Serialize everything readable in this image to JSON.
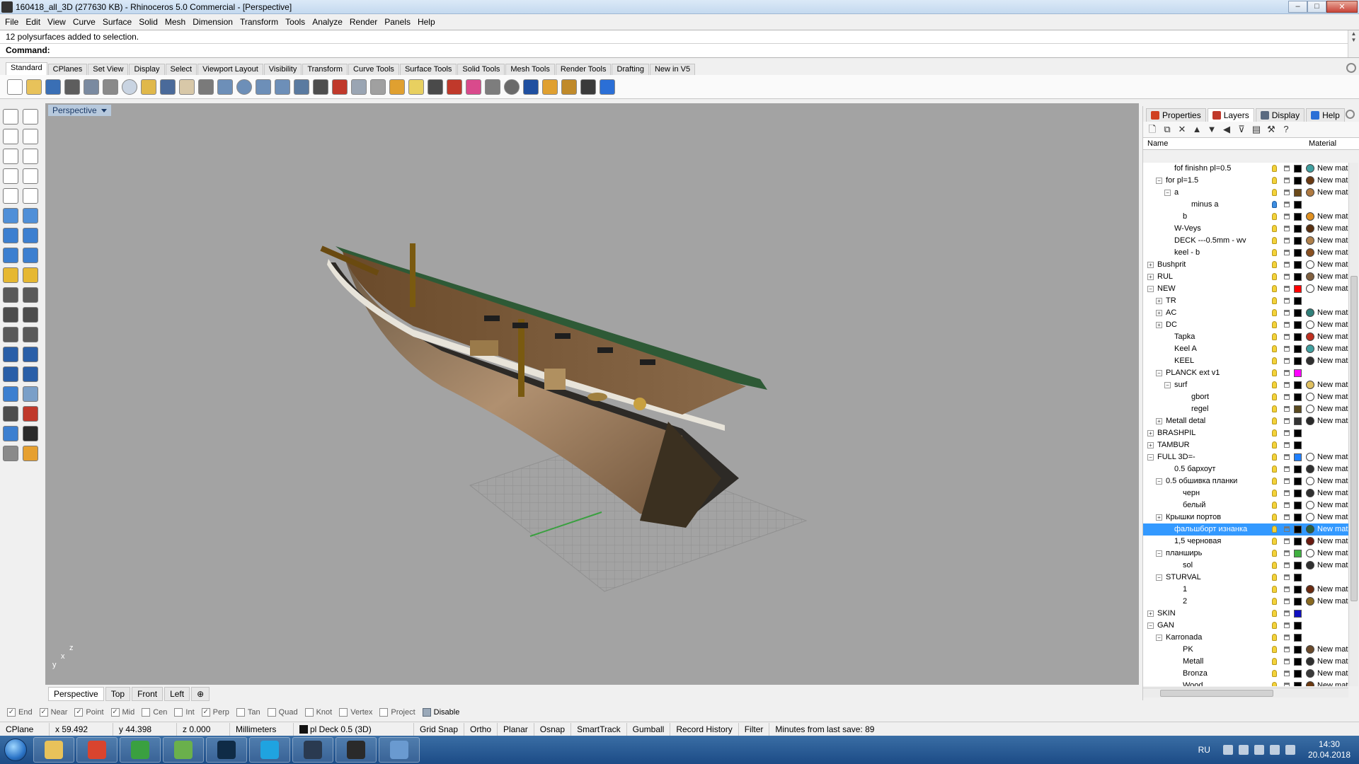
{
  "window": {
    "title": "160418_all_3D (277630 KB) - Rhinoceros 5.0 Commercial - [Perspective]",
    "minimize": "–",
    "maximize": "□",
    "close": "✕"
  },
  "menu": [
    "File",
    "Edit",
    "View",
    "Curve",
    "Surface",
    "Solid",
    "Mesh",
    "Dimension",
    "Transform",
    "Tools",
    "Analyze",
    "Render",
    "Panels",
    "Help"
  ],
  "command": {
    "history": "12 polysurfaces added to selection.",
    "prompt": "Command:",
    "scroll_up": "▲",
    "scroll_down": "▼"
  },
  "toolbar_tabs": [
    "Standard",
    "CPlanes",
    "Set View",
    "Display",
    "Select",
    "Viewport Layout",
    "Visibility",
    "Transform",
    "Curve Tools",
    "Surface Tools",
    "Solid Tools",
    "Mesh Tools",
    "Render Tools",
    "Drafting",
    "New in V5"
  ],
  "toolbar_icons": [
    {
      "name": "new-icon",
      "color": "#ffffff"
    },
    {
      "name": "open-icon",
      "color": "#e8c25a"
    },
    {
      "name": "save-icon",
      "color": "#3a6fb5"
    },
    {
      "name": "print-icon",
      "color": "#5d5d5d"
    },
    {
      "name": "import-icon",
      "color": "#7a8aa0"
    },
    {
      "name": "cut-icon",
      "color": "#8a8a8a"
    },
    {
      "name": "copy-icon",
      "color": "#c9d4e2"
    },
    {
      "name": "paste-icon",
      "color": "#e0b84a"
    },
    {
      "name": "undo-icon",
      "color": "#4a6a9a"
    },
    {
      "name": "pan-icon",
      "color": "#d8c8a8"
    },
    {
      "name": "rotate-view-icon",
      "color": "#7a7a7a"
    },
    {
      "name": "zoom-icon",
      "color": "#6d8fb8"
    },
    {
      "name": "zoom-window-icon",
      "color": "#6d8fb8"
    },
    {
      "name": "zoom-extents-icon",
      "color": "#6d8fb8"
    },
    {
      "name": "zoom-selected-icon",
      "color": "#6d8fb8"
    },
    {
      "name": "undo-view-icon",
      "color": "#5a7aa0"
    },
    {
      "name": "four-viewports-icon",
      "color": "#4d4d4d"
    },
    {
      "name": "car-icon",
      "color": "#c0392b"
    },
    {
      "name": "shade-icon",
      "color": "#9aa5b3"
    },
    {
      "name": "cplane-icon",
      "color": "#a0a0a0"
    },
    {
      "name": "points-icon",
      "color": "#e0a030"
    },
    {
      "name": "light-icon",
      "color": "#e8d060"
    },
    {
      "name": "lock-icon",
      "color": "#4a4a4a"
    },
    {
      "name": "layer-icon",
      "color": "#c0392b"
    },
    {
      "name": "color-wheel-icon",
      "color": "#d94a8c"
    },
    {
      "name": "sphere-icon",
      "color": "#7d7d7d"
    },
    {
      "name": "render-sphere-icon",
      "color": "#6a6a6a"
    },
    {
      "name": "material-sphere-icon",
      "color": "#1f4fa0"
    },
    {
      "name": "filter-icon",
      "color": "#e0a030"
    },
    {
      "name": "settings-icon",
      "color": "#c08a2a"
    },
    {
      "name": "dimension-icon",
      "color": "#3a3a3a"
    },
    {
      "name": "help-icon",
      "color": "#2b6fd6"
    }
  ],
  "left_tools": [
    {
      "name": "select-arrow-icon",
      "color": "#ffffff"
    },
    {
      "name": "point-icon",
      "color": "#ffffff"
    },
    {
      "name": "polyline-icon",
      "color": "#ffffff"
    },
    {
      "name": "curve-icon",
      "color": "#ffffff"
    },
    {
      "name": "circle-icon",
      "color": "#ffffff"
    },
    {
      "name": "arc-icon",
      "color": "#ffffff"
    },
    {
      "name": "polygon-icon",
      "color": "#ffffff"
    },
    {
      "name": "rectangle-icon",
      "color": "#ffffff"
    },
    {
      "name": "ellipse-icon",
      "color": "#ffffff"
    },
    {
      "name": "fillet-icon",
      "color": "#ffffff"
    },
    {
      "name": "surface-icon",
      "color": "#4f8fd8"
    },
    {
      "name": "loft-icon",
      "color": "#4f8fd8"
    },
    {
      "name": "box-icon",
      "color": "#3c7fd0"
    },
    {
      "name": "boolean-icon",
      "color": "#3c7fd0"
    },
    {
      "name": "cylinder-icon",
      "color": "#3c7fd0"
    },
    {
      "name": "mesh-icon",
      "color": "#3c7fd0"
    },
    {
      "name": "light-icon",
      "color": "#e6b832"
    },
    {
      "name": "dimension-icon",
      "color": "#e6b832"
    },
    {
      "name": "trim-icon",
      "color": "#5a5a5a"
    },
    {
      "name": "split-icon",
      "color": "#5a5a5a"
    },
    {
      "name": "join-icon",
      "color": "#4d4d4d"
    },
    {
      "name": "explode-icon",
      "color": "#4d4d4d"
    },
    {
      "name": "offset-icon",
      "color": "#5a5a5a"
    },
    {
      "name": "extend-icon",
      "color": "#5a5a5a"
    },
    {
      "name": "text-icon",
      "color": "#2a5fa8"
    },
    {
      "name": "scale-icon",
      "color": "#2a5fa8"
    },
    {
      "name": "move-icon",
      "color": "#2a5fa8"
    },
    {
      "name": "mirror-icon",
      "color": "#2a5fa8"
    },
    {
      "name": "array-icon",
      "color": "#3c7fd0"
    },
    {
      "name": "grid-icon",
      "color": "#7a9fc8"
    },
    {
      "name": "snap-icon",
      "color": "#4d4d4d"
    },
    {
      "name": "analyze-icon",
      "color": "#c0392b"
    },
    {
      "name": "check-icon",
      "color": "#3c7fd0"
    },
    {
      "name": "checkmark-icon",
      "color": "#2a2a2a"
    },
    {
      "name": "block-icon",
      "color": "#8a8a8a"
    },
    {
      "name": "render-icon",
      "color": "#e6a030"
    }
  ],
  "viewport": {
    "title": "Perspective",
    "axis_z": "z",
    "axis_x": "x",
    "axis_y": "y",
    "tabs": [
      "Perspective",
      "Top",
      "Front",
      "Left"
    ],
    "add_tab": "⊕"
  },
  "osnaps": [
    {
      "label": "End",
      "checked": true
    },
    {
      "label": "Near",
      "checked": true
    },
    {
      "label": "Point",
      "checked": true
    },
    {
      "label": "Mid",
      "checked": true
    },
    {
      "label": "Cen",
      "checked": false
    },
    {
      "label": "Int",
      "checked": false
    },
    {
      "label": "Perp",
      "checked": true
    },
    {
      "label": "Tan",
      "checked": false
    },
    {
      "label": "Quad",
      "checked": false
    },
    {
      "label": "Knot",
      "checked": false
    },
    {
      "label": "Vertex",
      "checked": false
    },
    {
      "label": "Project",
      "checked": false
    },
    {
      "label": "Disable",
      "checked": false
    }
  ],
  "status": {
    "cplane": "CPlane",
    "x": "x 59.492",
    "y": "y 44.398",
    "z": "z 0.000",
    "units": "Millimeters",
    "layer": "pl Deck 0.5 (3D)",
    "grid_snap": "Grid Snap",
    "ortho": "Ortho",
    "planar": "Planar",
    "osnap": "Osnap",
    "smarttrack": "SmartTrack",
    "gumball": "Gumball",
    "record_history": "Record History",
    "filter": "Filter",
    "save_info": "Minutes from last save: 89"
  },
  "panel": {
    "tabs": [
      {
        "label": "Properties",
        "color": "#d04020"
      },
      {
        "label": "Layers",
        "color": "#c0392b"
      },
      {
        "label": "Display",
        "color": "#5a6a80"
      },
      {
        "label": "Help",
        "color": "#2b6fd6"
      }
    ],
    "tool_icons": [
      {
        "name": "new-layer-icon",
        "glyph": "🗋"
      },
      {
        "name": "new-sublayer-icon",
        "glyph": "⧉"
      },
      {
        "name": "delete-icon",
        "glyph": "✕"
      },
      {
        "name": "move-up-icon",
        "glyph": "▲"
      },
      {
        "name": "move-down-icon",
        "glyph": "▼"
      },
      {
        "name": "move-parent-icon",
        "glyph": "◀"
      },
      {
        "name": "filter-icon",
        "glyph": "⊽"
      },
      {
        "name": "print-icon",
        "glyph": "▤"
      },
      {
        "name": "tools-icon",
        "glyph": "⚒"
      },
      {
        "name": "help-icon",
        "glyph": "?"
      }
    ],
    "col_name": "Name",
    "col_material": "Material"
  },
  "layers": [
    {
      "name": "fof finishn pl=0.5",
      "indent": 2,
      "toggle": "",
      "color": "#000000",
      "mat": "#40a0a0",
      "mtext": "New mat",
      "bulb": "yellow"
    },
    {
      "name": "for pl=1.5",
      "indent": 1,
      "toggle": "−",
      "color": "#000000",
      "mat": "#6b3a12",
      "mtext": "New mat",
      "bulb": "yellow"
    },
    {
      "name": "a",
      "indent": 2,
      "toggle": "−",
      "color": "#6b4a1a",
      "mat": "#b07a40",
      "mtext": "New mat",
      "bulb": "yellow"
    },
    {
      "name": "minus a",
      "indent": 4,
      "toggle": "",
      "color": "#000000",
      "mat": "",
      "mtext": "",
      "bulb": "blue"
    },
    {
      "name": "b",
      "indent": 3,
      "toggle": "",
      "color": "#000000",
      "mat": "#e09020",
      "mtext": "New mat",
      "bulb": "yellow"
    },
    {
      "name": "W-Veys",
      "indent": 2,
      "toggle": "",
      "color": "#000000",
      "mat": "#5a3010",
      "mtext": "New mat",
      "bulb": "yellow"
    },
    {
      "name": "DECK ---0.5mm - wv",
      "indent": 2,
      "toggle": "",
      "color": "#000000",
      "mat": "#b0804a",
      "mtext": "New mat",
      "bulb": "yellow"
    },
    {
      "name": "keel - b",
      "indent": 2,
      "toggle": "",
      "color": "#000000",
      "mat": "#8a5020",
      "mtext": "New mat",
      "bulb": "yellow"
    },
    {
      "name": "Bushprit",
      "indent": 0,
      "toggle": "+",
      "color": "#000000",
      "mat": "#ffffff",
      "mtext": "New mat",
      "bulb": "yellow"
    },
    {
      "name": "RUL",
      "indent": 0,
      "toggle": "+",
      "color": "#000000",
      "mat": "#806040",
      "mtext": "New mat",
      "bulb": "yellow"
    },
    {
      "name": "NEW",
      "indent": 0,
      "toggle": "−",
      "color": "#ff0000",
      "mat": "#ffffff",
      "mtext": "New mat",
      "bulb": "yellow"
    },
    {
      "name": "TR",
      "indent": 1,
      "toggle": "+",
      "color": "#000000",
      "mat": "",
      "mtext": "",
      "bulb": "yellow"
    },
    {
      "name": "AC",
      "indent": 1,
      "toggle": "+",
      "color": "#000000",
      "mat": "#30807a",
      "mtext": "New mat",
      "bulb": "yellow"
    },
    {
      "name": "DC",
      "indent": 1,
      "toggle": "+",
      "color": "#000000",
      "mat": "#ffffff",
      "mtext": "New mat",
      "bulb": "yellow"
    },
    {
      "name": "Tapka",
      "indent": 2,
      "toggle": "",
      "color": "#000000",
      "mat": "#c03020",
      "mtext": "New mat",
      "bulb": "yellow"
    },
    {
      "name": "Keel A",
      "indent": 2,
      "toggle": "",
      "color": "#000000",
      "mat": "#40a0a0",
      "mtext": "New mat",
      "bulb": "yellow"
    },
    {
      "name": "KEEL",
      "indent": 2,
      "toggle": "",
      "color": "#000000",
      "mat": "#303030",
      "mtext": "New mat",
      "bulb": "yellow"
    },
    {
      "name": "PLANCK ext v1",
      "indent": 1,
      "toggle": "−",
      "color": "#ff00ff",
      "mat": "",
      "mtext": "",
      "bulb": "yellow"
    },
    {
      "name": "surf",
      "indent": 2,
      "toggle": "−",
      "color": "#000000",
      "mat": "#e0c060",
      "mtext": "New mat",
      "bulb": "yellow"
    },
    {
      "name": "gbort",
      "indent": 4,
      "toggle": "",
      "color": "#000000",
      "mat": "#ffffff",
      "mtext": "New mat",
      "bulb": "yellow"
    },
    {
      "name": "regel",
      "indent": 4,
      "toggle": "",
      "color": "#5a4a20",
      "mat": "#ffffff",
      "mtext": "New mat",
      "bulb": "yellow"
    },
    {
      "name": "Metall detal",
      "indent": 1,
      "toggle": "+",
      "color": "#333333",
      "mat": "#2a2a2a",
      "mtext": "New mat",
      "bulb": "yellow"
    },
    {
      "name": "BRASHPIL",
      "indent": 0,
      "toggle": "+",
      "color": "#000000",
      "mat": "",
      "mtext": "",
      "bulb": "yellow"
    },
    {
      "name": "TAMBUR",
      "indent": 0,
      "toggle": "+",
      "color": "#000000",
      "mat": "",
      "mtext": "",
      "bulb": "yellow"
    },
    {
      "name": "FULL 3D=-",
      "indent": 0,
      "toggle": "−",
      "color": "#2080ff",
      "mat": "#ffffff",
      "mtext": "New mat",
      "bulb": "yellow"
    },
    {
      "name": "0.5 бархоут",
      "indent": 2,
      "toggle": "",
      "color": "#000000",
      "mat": "#303030",
      "mtext": "New mat",
      "bulb": "yellow"
    },
    {
      "name": "0.5 обшивка планки",
      "indent": 1,
      "toggle": "−",
      "color": "#000000",
      "mat": "#ffffff",
      "mtext": "New mat",
      "bulb": "yellow"
    },
    {
      "name": "черн",
      "indent": 3,
      "toggle": "",
      "color": "#000000",
      "mat": "#303030",
      "mtext": "New mat",
      "bulb": "yellow"
    },
    {
      "name": "белый",
      "indent": 3,
      "toggle": "",
      "color": "#000000",
      "mat": "#ffffff",
      "mtext": "New mat",
      "bulb": "yellow"
    },
    {
      "name": "Крышки портов",
      "indent": 1,
      "toggle": "+",
      "color": "#000000",
      "mat": "#ffffff",
      "mtext": "New mat",
      "bulb": "yellow"
    },
    {
      "name": "фальшборт изнанка",
      "indent": 2,
      "toggle": "",
      "color": "#000000",
      "mat": "#2a6040",
      "mtext": "New mat",
      "bulb": "yellow",
      "selected": true
    },
    {
      "name": "1,5 черновая",
      "indent": 2,
      "toggle": "",
      "color": "#000000",
      "mat": "#6b1a10",
      "mtext": "New mat",
      "bulb": "yellow"
    },
    {
      "name": "планширь",
      "indent": 1,
      "toggle": "−",
      "color": "#40b040",
      "mat": "#ffffff",
      "mtext": "New mat",
      "bulb": "yellow"
    },
    {
      "name": "sol",
      "indent": 3,
      "toggle": "",
      "color": "#000000",
      "mat": "#303030",
      "mtext": "New mat",
      "bulb": "yellow"
    },
    {
      "name": "STURVAL",
      "indent": 1,
      "toggle": "−",
      "color": "#000000",
      "mat": "",
      "mtext": "",
      "bulb": "yellow"
    },
    {
      "name": "1",
      "indent": 3,
      "toggle": "",
      "color": "#000000",
      "mat": "#6b2a10",
      "mtext": "New mat",
      "bulb": "yellow"
    },
    {
      "name": "2",
      "indent": 3,
      "toggle": "",
      "color": "#000000",
      "mat": "#8a6a20",
      "mtext": "New mat",
      "bulb": "yellow"
    },
    {
      "name": "SKIN",
      "indent": 0,
      "toggle": "+",
      "color": "#1010c0",
      "mat": "",
      "mtext": "",
      "bulb": "yellow"
    },
    {
      "name": "GAN",
      "indent": 0,
      "toggle": "−",
      "color": "#000000",
      "mat": "",
      "mtext": "",
      "bulb": "yellow"
    },
    {
      "name": "Karronada",
      "indent": 1,
      "toggle": "−",
      "color": "#000000",
      "mat": "",
      "mtext": "",
      "bulb": "yellow"
    },
    {
      "name": "PK",
      "indent": 3,
      "toggle": "",
      "color": "#000000",
      "mat": "#6a4a2a",
      "mtext": "New mat",
      "bulb": "yellow"
    },
    {
      "name": "Metall",
      "indent": 3,
      "toggle": "",
      "color": "#000000",
      "mat": "#303030",
      "mtext": "New mat",
      "bulb": "yellow"
    },
    {
      "name": "Bronza",
      "indent": 3,
      "toggle": "",
      "color": "#000000",
      "mat": "#3a3a3a",
      "mtext": "New mat",
      "bulb": "yellow"
    },
    {
      "name": "Wood",
      "indent": 3,
      "toggle": "",
      "color": "#000000",
      "mat": "#6b3a12",
      "mtext": "New mat",
      "bulb": "yellow"
    }
  ],
  "taskbar": {
    "apps": [
      {
        "name": "explorer-icon",
        "color": "#e8c25a"
      },
      {
        "name": "chrome-icon",
        "color": "#d9442e"
      },
      {
        "name": "sketchup-icon",
        "color": "#3aa040"
      },
      {
        "name": "evernote-icon",
        "color": "#6ab04c"
      },
      {
        "name": "photoshop-icon",
        "color": "#0f2b46"
      },
      {
        "name": "skype-icon",
        "color": "#1fa3e0"
      },
      {
        "name": "autocad-icon",
        "color": "#2a3a50"
      },
      {
        "name": "rhino-icon",
        "color": "#2a2a2a"
      },
      {
        "name": "window-icon",
        "color": "#6a9ad0"
      }
    ],
    "lang": "RU",
    "time": "14:30",
    "date": "20.04.2018"
  }
}
